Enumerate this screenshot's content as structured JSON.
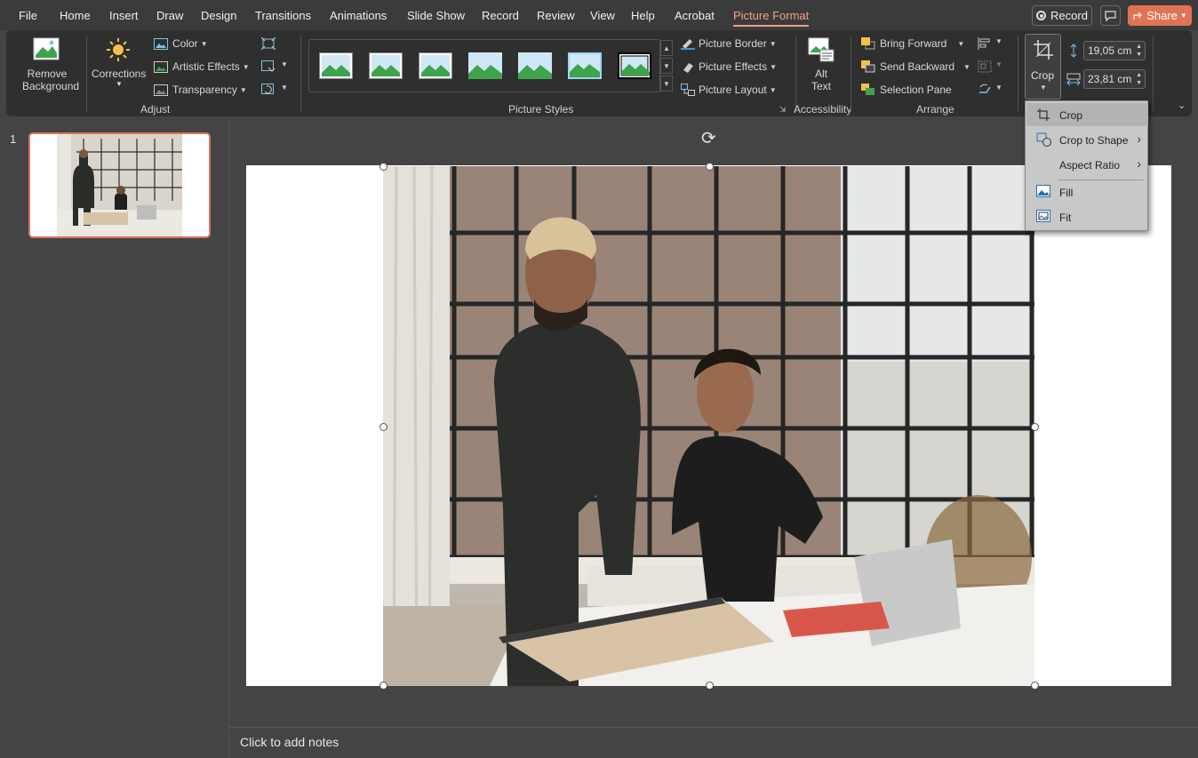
{
  "menu": {
    "tabs": [
      "File",
      "Home",
      "Insert",
      "Draw",
      "Design",
      "Transitions",
      "Animations",
      "Slide Show",
      "Record",
      "Review",
      "View",
      "Help",
      "Acrobat",
      "Picture Format"
    ],
    "active_tab": "Picture Format",
    "record_label": "Record",
    "share_label": "Share"
  },
  "ribbon": {
    "adjust": {
      "remove_background": [
        "Remove",
        "Background"
      ],
      "corrections": "Corrections",
      "color": "Color",
      "artistic_effects": "Artistic Effects",
      "transparency": "Transparency",
      "label": "Adjust"
    },
    "picture_styles": {
      "label": "Picture Styles",
      "picture_border": "Picture Border",
      "picture_effects": "Picture Effects",
      "picture_layout": "Picture Layout"
    },
    "accessibility": {
      "alt_text": [
        "Alt",
        "Text"
      ],
      "label": "Accessibility"
    },
    "arrange": {
      "bring_forward": "Bring Forward",
      "send_backward": "Send Backward",
      "selection_pane": "Selection Pane",
      "label": "Arrange"
    },
    "size": {
      "crop": "Crop",
      "height": "19,05 cm",
      "width": "23,81 cm"
    }
  },
  "crop_menu": {
    "items": [
      {
        "label": "Crop",
        "icon": "crop-icon",
        "submenu": false
      },
      {
        "label": "Crop to Shape",
        "icon": "crop-to-shape-icon",
        "submenu": true
      },
      {
        "label": "Aspect Ratio",
        "icon": "",
        "submenu": true
      },
      {
        "label": "Fill",
        "icon": "fill-icon",
        "submenu": false
      },
      {
        "label": "Fit",
        "icon": "fit-icon",
        "submenu": false
      }
    ]
  },
  "slides": {
    "current_number": "1"
  },
  "notes": {
    "placeholder": "Click to add notes"
  },
  "colors": {
    "accent": "#f4a08c",
    "share": "#e07356",
    "thumb_border": "#e0735f"
  }
}
